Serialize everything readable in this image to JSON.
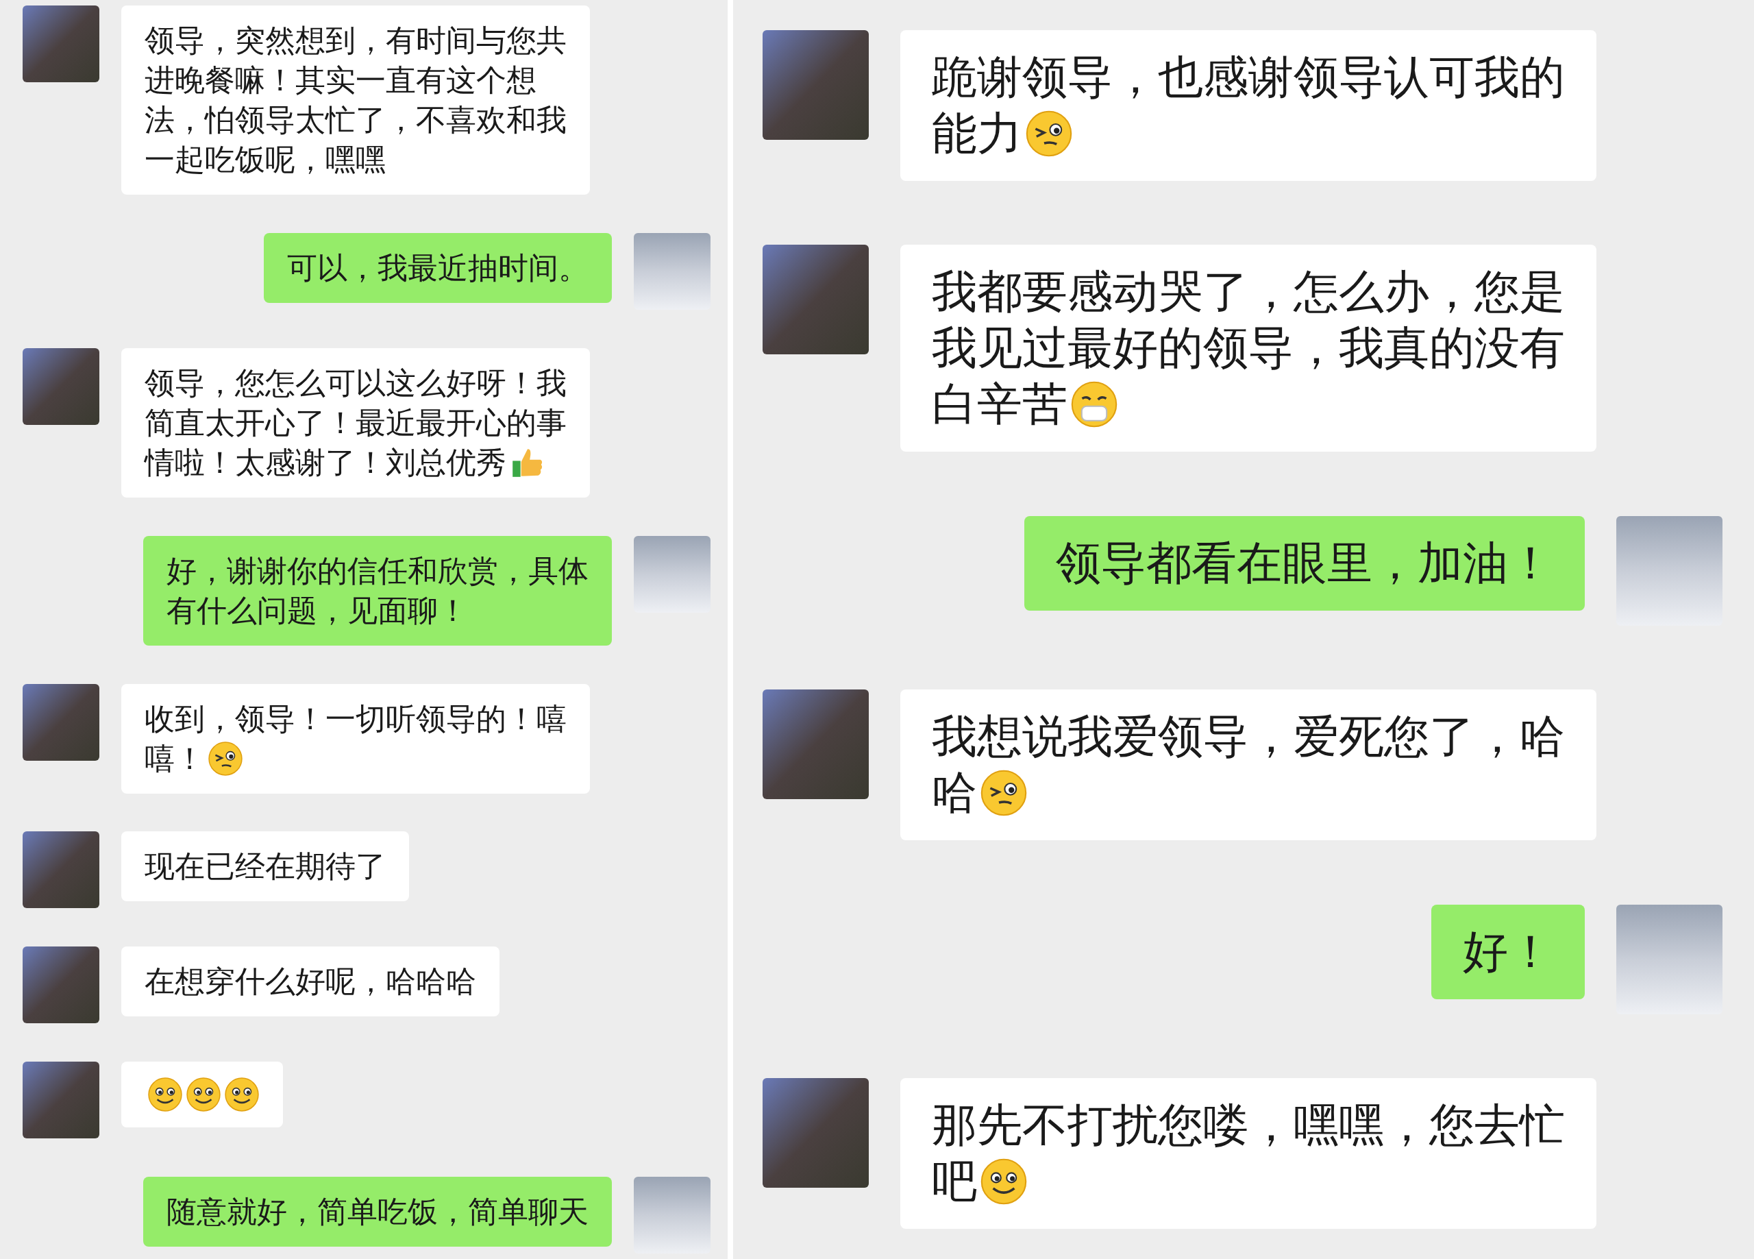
{
  "panels": [
    {
      "messages": [
        {
          "kind": "incoming",
          "lines": [
            "领导，突然想到，有时间与您共",
            "进晚餐嘛！其实一直有这个想",
            "法，怕领导太忙了，不喜欢和我",
            "一起吃饭呢，嘿嘿"
          ]
        },
        {
          "kind": "outgoing",
          "lines": [
            "可以，我最近抽时间。"
          ]
        },
        {
          "kind": "incoming",
          "lines": [
            "领导，您怎么可以这么好呀！我",
            "简直太开心了！最近最开心的事",
            "情啦！太感谢了！刘总优秀"
          ],
          "emojis": [
            {
              "kind": "thumbs"
            }
          ]
        },
        {
          "kind": "outgoing",
          "lines": [
            "好，谢谢你的信任和欣赏，具体",
            "有什么问题，见面聊！"
          ]
        },
        {
          "kind": "incoming",
          "lines": [
            "收到，领导！一切听领导的！嘻",
            "嘻！"
          ],
          "emojis": [
            {
              "kind": "wink"
            }
          ]
        },
        {
          "kind": "incoming",
          "lines": [
            "现在已经在期待了"
          ]
        },
        {
          "kind": "incoming",
          "lines": [
            "在想穿什么好呢，哈哈哈"
          ]
        },
        {
          "kind": "incoming",
          "emojis": [
            {
              "kind": "smile"
            },
            {
              "kind": "smile"
            },
            {
              "kind": "smile"
            }
          ]
        },
        {
          "kind": "outgoing",
          "lines": [
            "随意就好，简单吃饭，简单聊天"
          ]
        }
      ]
    },
    {
      "messages": [
        {
          "kind": "incoming",
          "lines": [
            "跪谢领导，也感谢领导认可我的",
            "能力"
          ],
          "emojis": [
            {
              "kind": "wink"
            }
          ]
        },
        {
          "kind": "incoming",
          "lines": [
            "我都要感动哭了，怎么办，您是",
            "我见过最好的领导，我真的没有",
            "白辛苦"
          ],
          "emojis": [
            {
              "kind": "mask"
            }
          ]
        },
        {
          "kind": "outgoing",
          "lines": [
            "领导都看在眼里，加油！"
          ]
        },
        {
          "kind": "incoming",
          "lines": [
            "我想说我爱领导，爱死您了，哈",
            "哈"
          ],
          "emojis": [
            {
              "kind": "wink"
            }
          ]
        },
        {
          "kind": "outgoing",
          "lines": [
            "好！"
          ]
        },
        {
          "kind": "incoming",
          "lines": [
            "那先不打扰您喽，嘿嘿，您去忙",
            "吧"
          ],
          "emojis": [
            {
              "kind": "smile"
            }
          ]
        }
      ]
    }
  ]
}
